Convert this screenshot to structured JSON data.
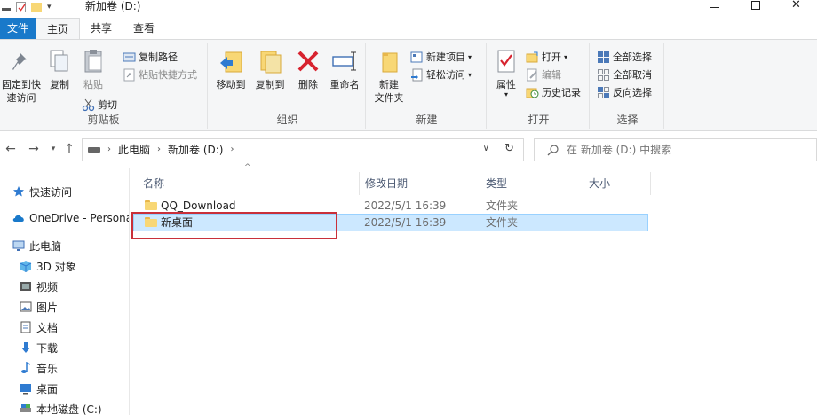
{
  "window": {
    "title": "新加卷 (D:)"
  },
  "tabs": [
    {
      "label": "文件"
    },
    {
      "label": "主页"
    },
    {
      "label": "共享"
    },
    {
      "label": "查看"
    }
  ],
  "ribbon": {
    "clipboard": {
      "label": "剪贴板",
      "pin_label_1": "固定到快",
      "pin_label_2": "速访问",
      "copy_label": "复制",
      "paste_label": "粘贴",
      "copy_path_label": "复制路径",
      "paste_shortcut_label": "粘贴快捷方式",
      "cut_label": "剪切"
    },
    "organize": {
      "label": "组织",
      "move_to_label": "移动到",
      "copy_to_label": "复制到",
      "delete_label": "删除",
      "rename_label": "重命名"
    },
    "new": {
      "label": "新建",
      "new_folder_label_1": "新建",
      "new_folder_label_2": "文件夹",
      "new_item_label": "新建项目",
      "easy_access_label": "轻松访问"
    },
    "open": {
      "label": "打开",
      "properties_label": "属性",
      "open_label": "打开",
      "edit_label": "编辑",
      "history_label": "历史记录"
    },
    "select": {
      "label": "选择",
      "select_all_label": "全部选择",
      "select_none_label": "全部取消",
      "invert_label": "反向选择"
    }
  },
  "address": {
    "crumbs": [
      "此电脑",
      "新加卷 (D:)"
    ]
  },
  "search": {
    "placeholder": "在 新加卷 (D:) 中搜索"
  },
  "nav_pane": {
    "items": [
      {
        "label": "快速访问"
      },
      {
        "label": "OneDrive - Persona"
      },
      {
        "label": "此电脑"
      },
      {
        "label": "3D 对象"
      },
      {
        "label": "视频"
      },
      {
        "label": "图片"
      },
      {
        "label": "文档"
      },
      {
        "label": "下载"
      },
      {
        "label": "音乐"
      },
      {
        "label": "桌面"
      },
      {
        "label": "本地磁盘 (C:)"
      }
    ]
  },
  "columns": [
    "名称",
    "修改日期",
    "类型",
    "大小"
  ],
  "files": [
    {
      "name": "QQ_Download",
      "date": "2022/5/1 16:39",
      "type": "文件夹",
      "size": ""
    },
    {
      "name": "新桌面",
      "date": "2022/5/1 16:39",
      "type": "文件夹",
      "size": ""
    }
  ],
  "colors": {
    "accent": "#1979ca",
    "selection": "#cce8ff",
    "highlight_border": "#c9303a",
    "folder": "#f8d775"
  }
}
